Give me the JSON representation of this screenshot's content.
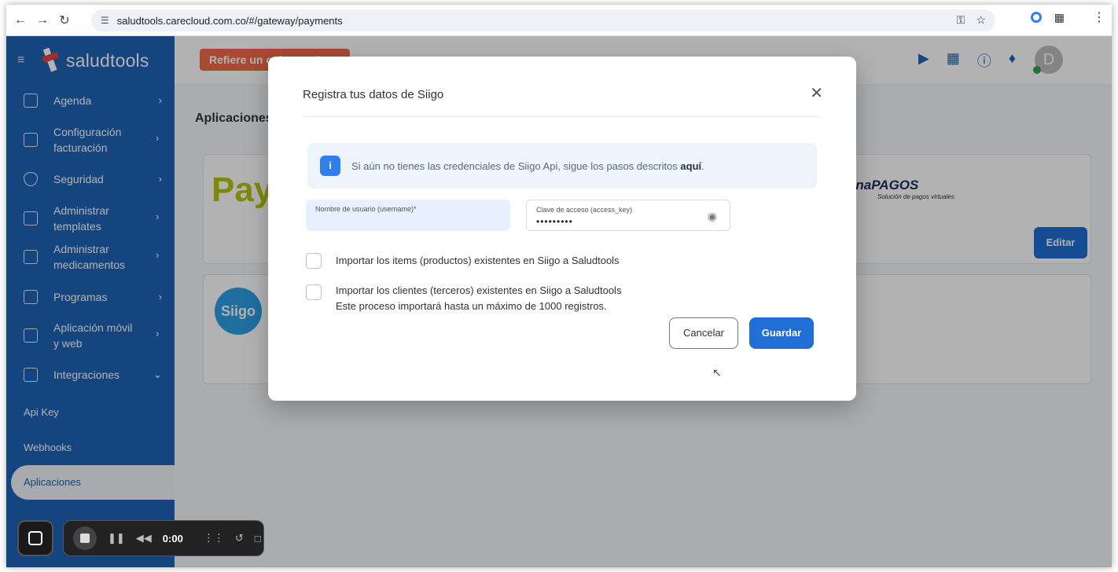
{
  "browser": {
    "url": "saludtools.carecloud.com.co/#/gateway/payments",
    "nav_icons": [
      "back-icon",
      "forward-icon",
      "reload-icon"
    ]
  },
  "app": {
    "logo_text": "saludtools",
    "refer_label": "Refiere un colega y Gana",
    "avatar_letter": "D",
    "sidebar": {
      "items": [
        {
          "label": "Agenda",
          "icon": "calendar-icon"
        },
        {
          "label": "Configuración facturación",
          "icon": "billing-icon"
        },
        {
          "label": "Seguridad",
          "icon": "shield-icon"
        },
        {
          "label": "Administrar templates",
          "icon": "document-icon"
        },
        {
          "label": "Administrar medicamentos",
          "icon": "medicine-icon"
        },
        {
          "label": "Programas",
          "icon": "programs-icon"
        },
        {
          "label": "Aplicación móvil y web",
          "icon": "mobile-icon"
        },
        {
          "label": "Integraciones",
          "icon": "integrations-icon"
        }
      ],
      "subitems": [
        "Api Key",
        "Webhooks",
        "Aplicaciones"
      ],
      "active_subitem": "Aplicaciones"
    },
    "section_title": "Aplicaciones",
    "cards": {
      "pay_text": "Pay",
      "siigo_text": "Siigo",
      "zona_logo": "onaPAGOS",
      "zona_sub": "Solución de pagos virtuales",
      "edit_label": "Editar"
    }
  },
  "modal": {
    "title": "Registra tus datos de Siigo",
    "info_text": "Si aún no tienes las credenciales de Siigo Api, sigue los pasos descritos ",
    "info_link": "aquí",
    "username_label": "Nombre de usuario (username)*",
    "username_value": "",
    "key_label": "Clave de acceso (access_key)",
    "key_value": "•••••••••",
    "check1": "Importar los items (productos) existentes en Siigo a Saludtools",
    "check2": "Importar los clientes (terceros) existentes en Siigo a Saludtools",
    "check2_sub": "Este proceso importará hasta un máximo de 1000 registros.",
    "cancel_label": "Cancelar",
    "save_label": "Guardar"
  },
  "recorder": {
    "time": "0:00"
  },
  "colors": {
    "sidebar": "#1f63b5",
    "primary_button": "#1f6fd6",
    "refer": "#ef6a47"
  }
}
